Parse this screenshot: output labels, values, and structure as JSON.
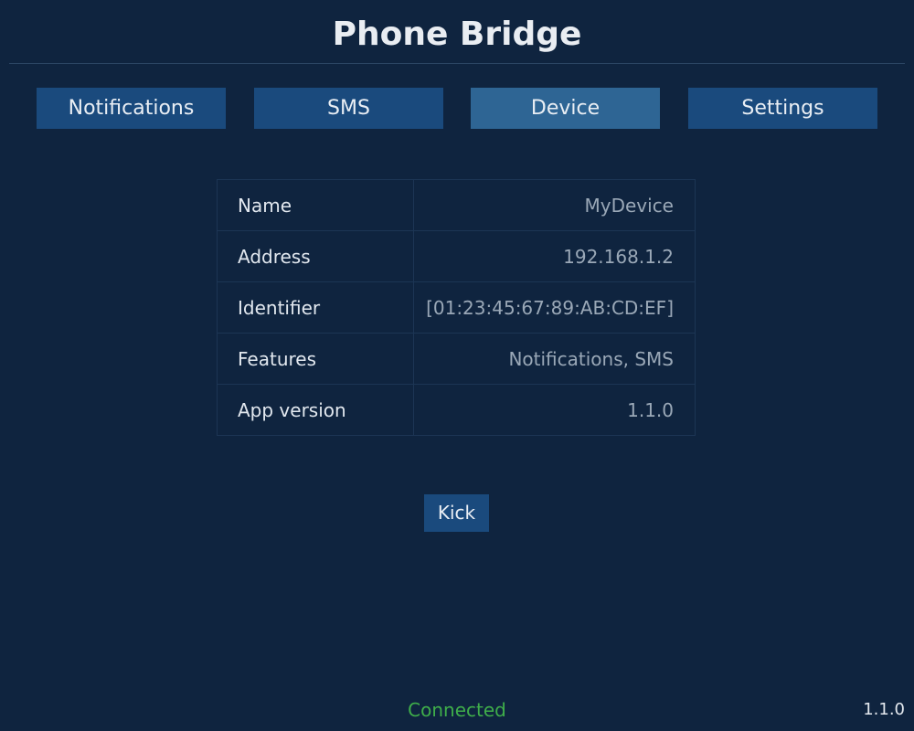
{
  "app": {
    "title": "Phone Bridge"
  },
  "tabs": [
    {
      "label": "Notifications",
      "active": false
    },
    {
      "label": "SMS",
      "active": false
    },
    {
      "label": "Device",
      "active": true
    },
    {
      "label": "Settings",
      "active": false
    }
  ],
  "device": {
    "rows": [
      {
        "key": "Name",
        "value": "MyDevice"
      },
      {
        "key": "Address",
        "value": "192.168.1.2"
      },
      {
        "key": "Identifier",
        "value": "[01:23:45:67:89:AB:CD:EF]"
      },
      {
        "key": "Features",
        "value": "Notifications, SMS"
      },
      {
        "key": "App version",
        "value": "1.1.0"
      }
    ],
    "kick_label": "Kick"
  },
  "footer": {
    "status": "Connected",
    "version": "1.1.0"
  },
  "colors": {
    "background": "#0f243f",
    "tab": "#1a4a7d",
    "tab_active": "#2e6594",
    "status_ok": "#3fae4a"
  }
}
